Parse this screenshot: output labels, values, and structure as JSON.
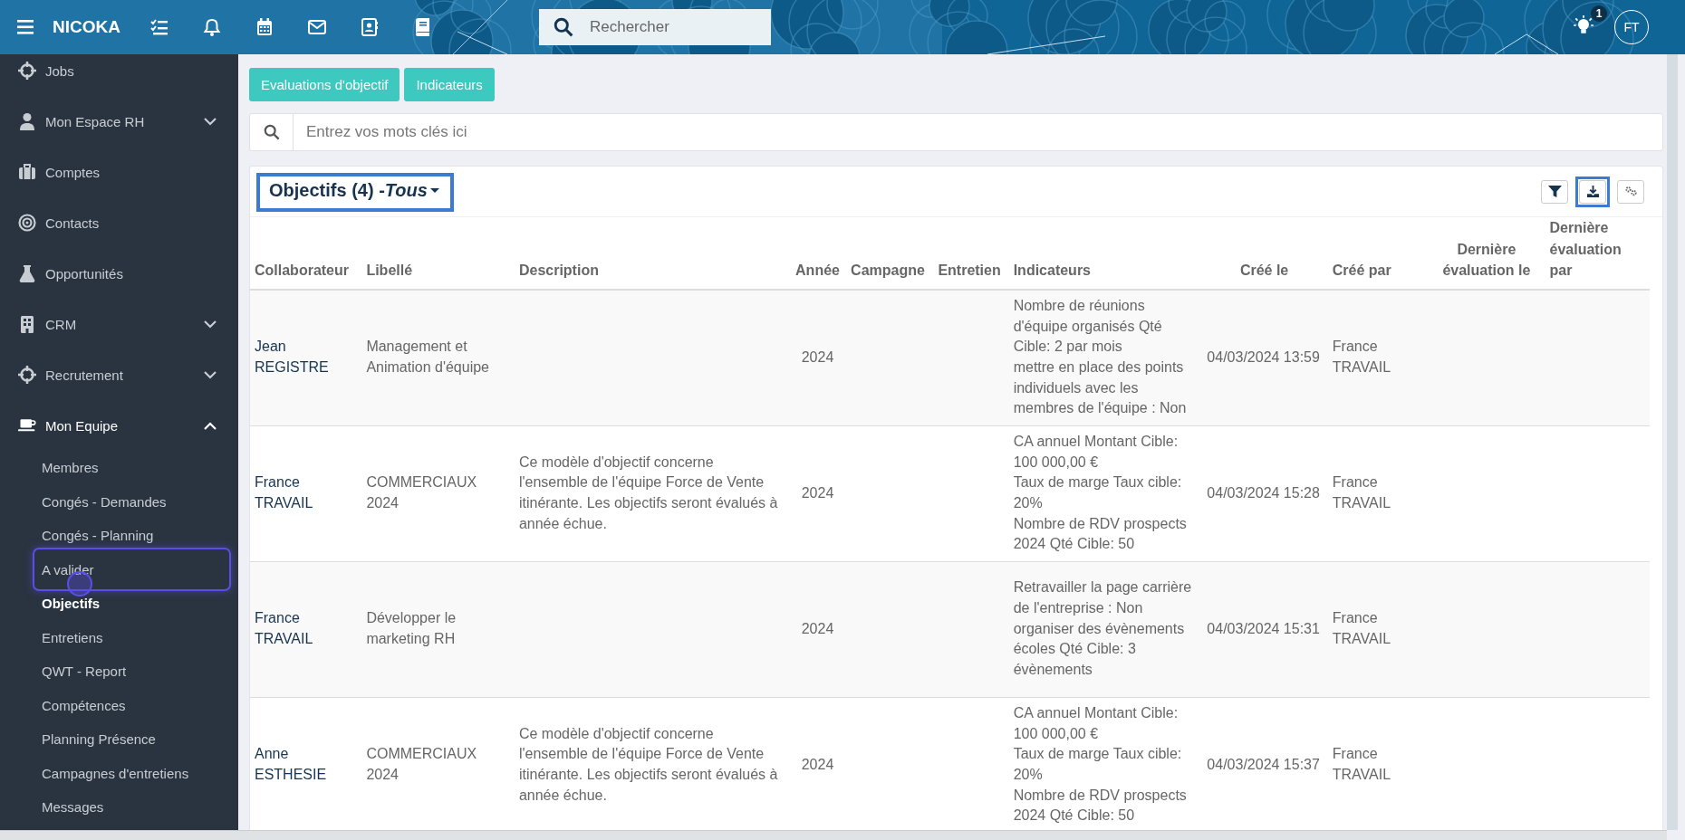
{
  "topbar": {
    "brand": "NICOKA",
    "search": {
      "placeholder": "Rechercher"
    },
    "notification_count": "1",
    "avatar": "FT"
  },
  "sidebar": {
    "items": [
      {
        "label": "Jobs",
        "kind": "link"
      },
      {
        "label": "Mon Espace RH",
        "kind": "group",
        "expanded": false
      },
      {
        "label": "Comptes",
        "kind": "link"
      },
      {
        "label": "Contacts",
        "kind": "link"
      },
      {
        "label": "Opportunités",
        "kind": "link"
      },
      {
        "label": "CRM",
        "kind": "group",
        "expanded": false
      },
      {
        "label": "Recrutement",
        "kind": "group",
        "expanded": false
      },
      {
        "label": "Mon Equipe",
        "kind": "group",
        "expanded": true,
        "children": [
          {
            "label": "Membres",
            "selected": false,
            "highlighted": false
          },
          {
            "label": "Congés - Demandes",
            "selected": false,
            "highlighted": false
          },
          {
            "label": "Congés - Planning",
            "selected": false,
            "highlighted": false
          },
          {
            "label": "A valider",
            "selected": false,
            "highlighted": true
          },
          {
            "label": "Objectifs",
            "selected": true,
            "highlighted": false
          },
          {
            "label": "Entretiens",
            "selected": false,
            "highlighted": false
          },
          {
            "label": "QWT - Report",
            "selected": false,
            "highlighted": false
          },
          {
            "label": "Compétences",
            "selected": false,
            "highlighted": false
          },
          {
            "label": "Planning Présence",
            "selected": false,
            "highlighted": false
          },
          {
            "label": "Campagnes d'entretiens",
            "selected": false,
            "highlighted": false
          },
          {
            "label": "Messages",
            "selected": false,
            "highlighted": false
          }
        ]
      }
    ]
  },
  "actions": [
    "Evaluations d'objectif",
    "Indicateurs"
  ],
  "search": {
    "placeholder": "Entrez vos mots clés ici"
  },
  "card": {
    "title": "Objectifs (4) - ",
    "filter": "Tous",
    "highlighted": true,
    "tools": [
      {
        "kind": "filter",
        "highlighted": false
      },
      {
        "kind": "download",
        "highlighted": true
      },
      {
        "kind": "settings",
        "highlighted": false
      }
    ],
    "columns": [
      "Collaborateur",
      "Libellé",
      "Description",
      "Année",
      "Campagne",
      "Entretien",
      "Indicateurs",
      "Créé le",
      "Créé par",
      "Dernière évaluation le",
      "Dernière évaluation par"
    ],
    "rows": [
      {
        "collaborator": "Jean REGISTRE",
        "label": "Management et Animation d'équipe",
        "year": "2024",
        "indicators": [
          "Nombre de réunions d'équipe organisés Qté Cible: 2 par mois",
          "mettre en place des points individuels avec les membres de l'équipe : Non"
        ],
        "created_at": "04/03/2024 13:59",
        "created_by": "France TRAVAIL"
      },
      {
        "collaborator": "France TRAVAIL",
        "label": "COMMERCIAUX 2024",
        "description": "Ce modèle d'objectif concerne l'ensemble de l'équipe Force de Vente itinérante. Les objectifs seront évalués à année échue.",
        "year": "2024",
        "indicators": [
          "CA annuel Montant Cible: 100 000,00 €",
          "Taux de marge Taux cible: 20%",
          "Nombre de RDV prospects 2024 Qté Cible: 50"
        ],
        "created_at": "04/03/2024 15:28",
        "created_by": "France TRAVAIL"
      },
      {
        "collaborator": "France TRAVAIL",
        "label": "Développer le marketing RH",
        "year": "2024",
        "indicators": [
          "Retravailler la page carrière de l'entreprise : Non",
          "organiser des évènements écoles Qté Cible: 3 évènements"
        ],
        "created_at": "04/03/2024 15:31",
        "created_by": "France TRAVAIL"
      },
      {
        "collaborator": "Anne ESTHESIE",
        "label": "COMMERCIAUX 2024",
        "description": "Ce modèle d'objectif concerne l'ensemble de l'équipe Force de Vente itinérante. Les objectifs seront évalués à année échue.",
        "year": "2024",
        "indicators": [
          "CA annuel Montant Cible: 100 000,00 €",
          "Taux de marge Taux cible: 20%",
          "Nombre de RDV prospects 2024 Qté Cible: 50"
        ],
        "created_at": "04/03/2024 15:37",
        "created_by": "France TRAVAIL"
      }
    ]
  }
}
